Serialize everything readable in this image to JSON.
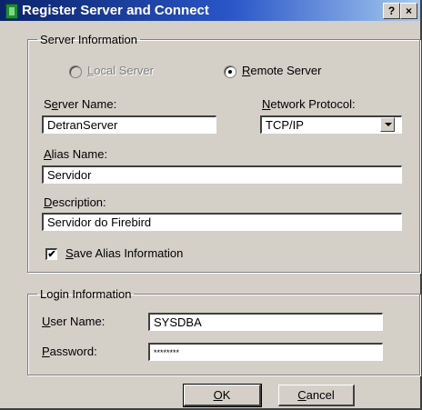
{
  "window": {
    "title": "Register Server and Connect",
    "help_button": "?",
    "close_button": "×"
  },
  "server_info": {
    "legend": "Server Information",
    "local_server": {
      "accel": "L",
      "rest": "ocal Server"
    },
    "remote_server": {
      "accel": "R",
      "rest": "emote Server"
    },
    "server_name": {
      "label_pre": "S",
      "accel": "e",
      "label_post": "rver Name:",
      "value": "DetranServer"
    },
    "network_protocol": {
      "accel": "N",
      "label_post": "etwork Protocol:",
      "value": "TCP/IP"
    },
    "alias_name": {
      "accel": "A",
      "label_post": "lias Name:",
      "value": "Servidor"
    },
    "description": {
      "accel": "D",
      "label_post": "escription:",
      "value": "Servidor do Firebird"
    },
    "save_alias": {
      "accel": "S",
      "label_post": "ave Alias Information",
      "checked": true,
      "check_glyph": "✔"
    }
  },
  "login_info": {
    "legend": "Login Information",
    "user_name": {
      "accel": "U",
      "label_post": "ser Name:",
      "value": "SYSDBA"
    },
    "password": {
      "accel": "P",
      "label_post": "assword:",
      "value": "********"
    }
  },
  "buttons": {
    "ok": {
      "accel": "O",
      "rest": "K"
    },
    "cancel": {
      "accel": "C",
      "rest": "ancel"
    }
  }
}
